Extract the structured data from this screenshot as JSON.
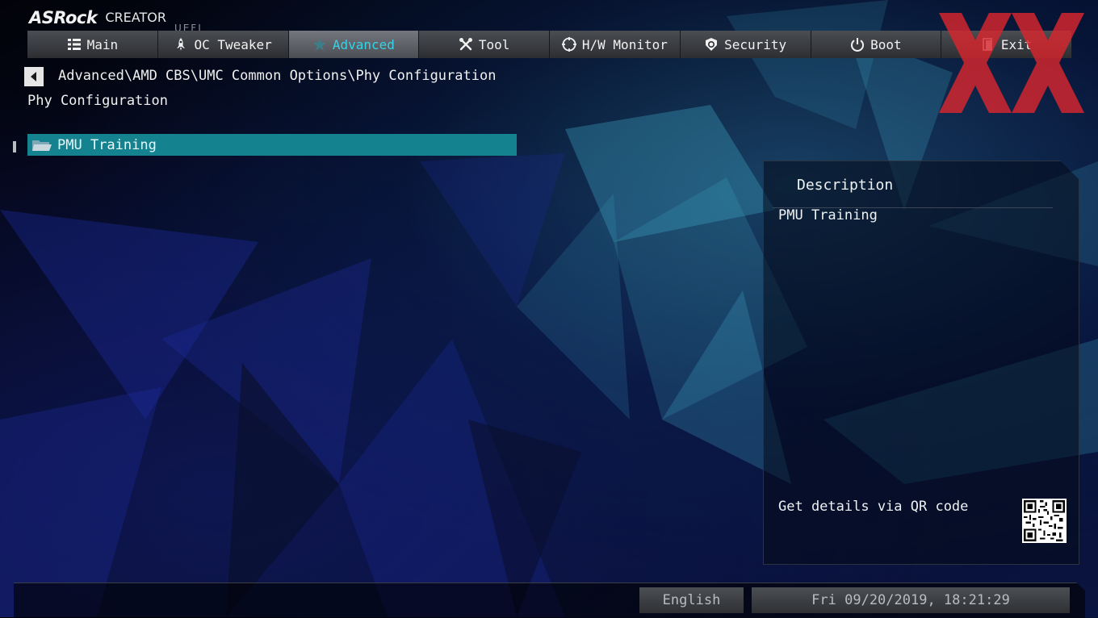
{
  "brand": {
    "name": "ASRock",
    "product": "CREATOR",
    "suffix": "UEFI"
  },
  "tabs": [
    {
      "label": "Main",
      "icon": "list-icon",
      "active": false
    },
    {
      "label": "OC Tweaker",
      "icon": "rocket-icon",
      "active": false
    },
    {
      "label": "Advanced",
      "icon": "star-icon",
      "active": true
    },
    {
      "label": "Tool",
      "icon": "tools-icon",
      "active": false
    },
    {
      "label": "H/W Monitor",
      "icon": "monitor-icon",
      "active": false
    },
    {
      "label": "Security",
      "icon": "shield-icon",
      "active": false
    },
    {
      "label": "Boot",
      "icon": "power-icon",
      "active": false
    },
    {
      "label": "Exit",
      "icon": "exit-icon",
      "active": false
    }
  ],
  "breadcrumb": "Advanced\\AMD CBS\\UMC Common Options\\Phy Configuration",
  "page_title": "Phy Configuration",
  "items": [
    {
      "label": "PMU Training",
      "icon": "folder-icon",
      "selected": true
    }
  ],
  "description": {
    "heading": "Description",
    "text": "PMU Training",
    "qr_text": "Get details via QR code"
  },
  "footer": {
    "language": "English",
    "datetime": "Fri 09/20/2019, 18:21:29"
  },
  "colors": {
    "accent_cyan": "#34d3e8",
    "selection_teal": "#14838f",
    "watermark_red": "#d8262e"
  }
}
